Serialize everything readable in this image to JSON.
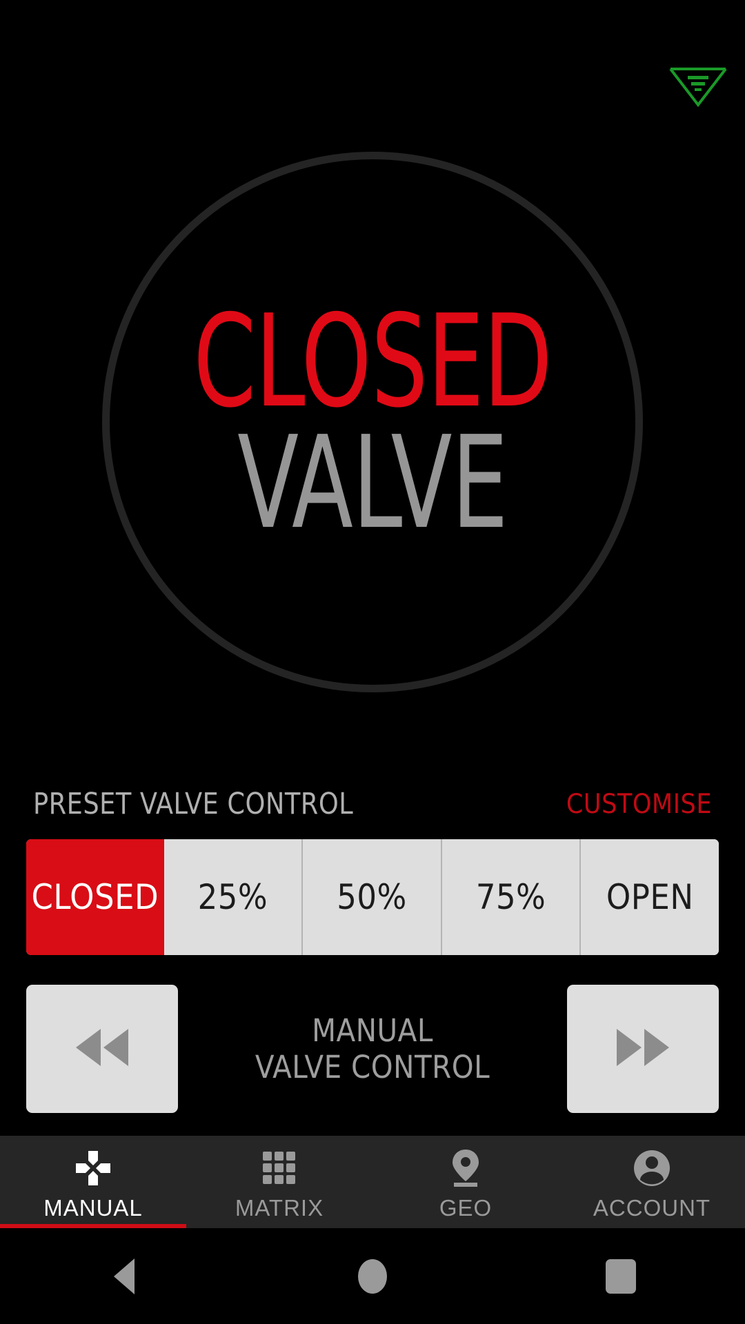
{
  "brand": {
    "logo_icon": "valve-v-logo-icon",
    "logo_color": "#1a9a28"
  },
  "dial": {
    "state": "CLOSED",
    "subject": "VALVE",
    "state_color": "#e00a16",
    "subject_color": "#969696",
    "ring_color": "#242424"
  },
  "preset": {
    "title": "PRESET VALVE CONTROL",
    "customise_label": "CUSTOMISE",
    "customise_color": "#c00a14",
    "active_color": "#d90d15",
    "inactive_color": "#dedede",
    "selected_index": 0,
    "segments": [
      {
        "label": "CLOSED",
        "active": true
      },
      {
        "label": "25%",
        "active": false
      },
      {
        "label": "50%",
        "active": false
      },
      {
        "label": "75%",
        "active": false
      },
      {
        "label": "OPEN",
        "active": false
      }
    ]
  },
  "manual": {
    "label_line1": "MANUAL",
    "label_line2": "VALVE CONTROL",
    "decrease_icon": "rewind-double-left-arrow-icon",
    "increase_icon": "fast-forward-double-right-arrow-icon"
  },
  "tabs": [
    {
      "label": "MANUAL",
      "icon": "dpad-crosshair-icon",
      "active": true
    },
    {
      "label": "MATRIX",
      "icon": "grid-3x3-icon",
      "active": false
    },
    {
      "label": "GEO",
      "icon": "map-pin-icon",
      "active": false
    },
    {
      "label": "ACCOUNT",
      "icon": "person-avatar-icon",
      "active": false
    }
  ],
  "tabbar": {
    "background": "#262626",
    "active_indicator_color": "#cf0d16"
  },
  "system_bar": {
    "back_icon": "back-triangle-icon",
    "home_icon": "home-circle-icon",
    "recents_icon": "recents-square-icon"
  }
}
